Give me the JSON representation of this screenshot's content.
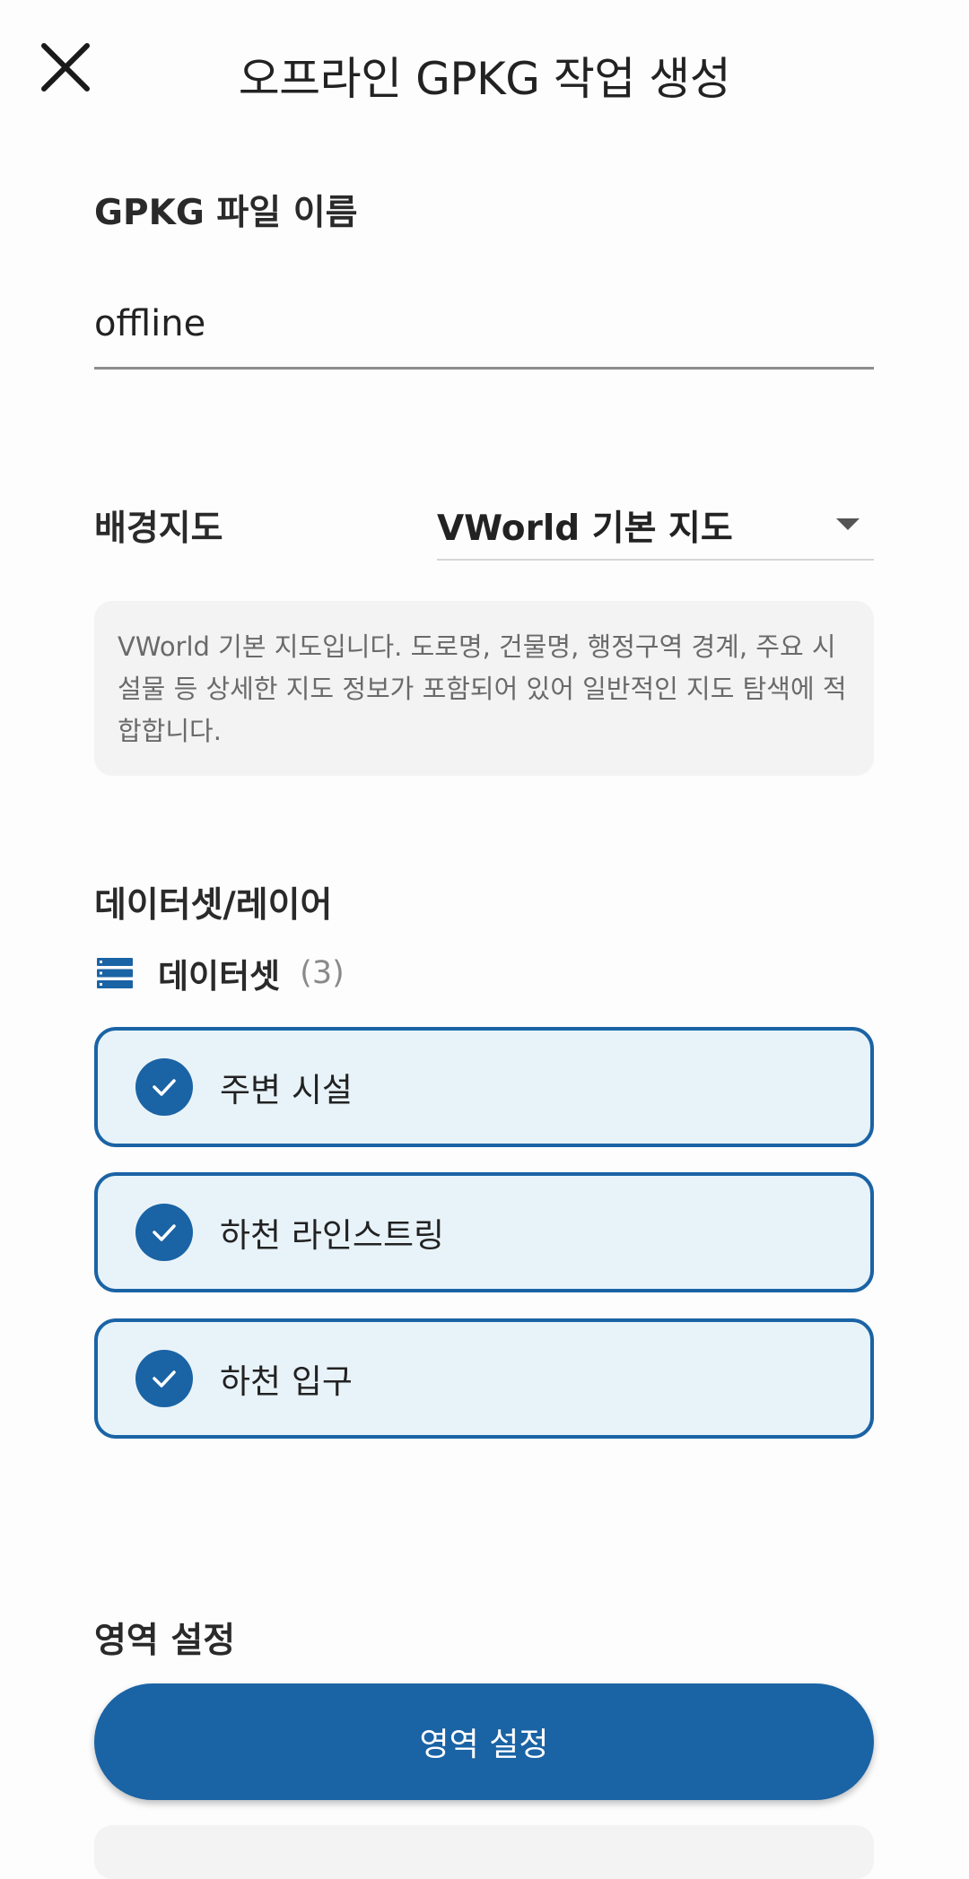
{
  "header": {
    "title": "오프라인 GPKG 작업 생성",
    "close_icon": "close-icon"
  },
  "gpkg_name": {
    "label": "GPKG 파일 이름",
    "value": "offline"
  },
  "basemap": {
    "label": "배경지도",
    "selected": "VWorld 기본 지도",
    "description": "VWorld 기본 지도입니다. 도로명, 건물명, 행정구역 경계, 주요 시설물 등 상세한 지도 정보가 포함되어 있어 일반적인 지도 탐색에 적합합니다."
  },
  "datasets": {
    "section_label": "데이터셋/레이어",
    "header_label": "데이터셋",
    "header_icon": "list-icon",
    "count": "(3)",
    "items": [
      {
        "label": "주변 시설",
        "checked": true
      },
      {
        "label": "하천 라인스트링",
        "checked": true
      },
      {
        "label": "하천 입구",
        "checked": true
      }
    ]
  },
  "area": {
    "section_label": "영역 설정",
    "button_label": "영역 설정"
  },
  "colors": {
    "accent": "#1a63a5",
    "item_background": "#e8f3f9",
    "description_background": "#f3f3f3"
  }
}
